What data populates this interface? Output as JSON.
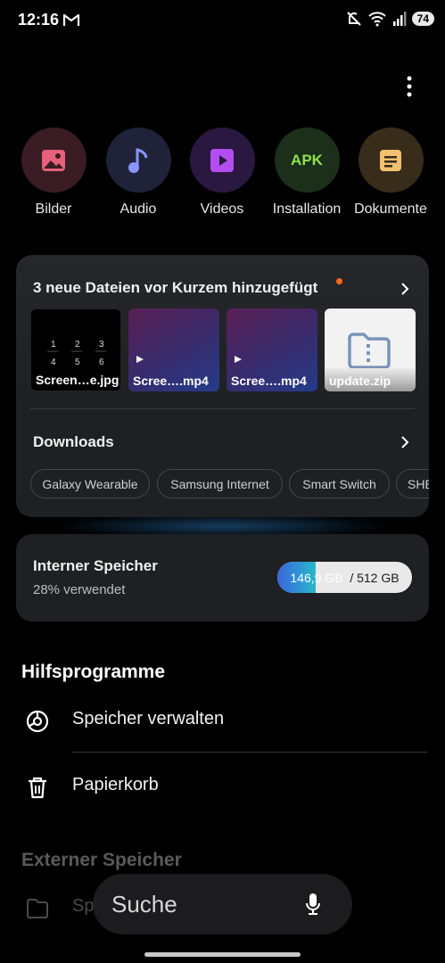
{
  "status": {
    "time": "12:16",
    "battery": "74"
  },
  "categories": [
    {
      "label": "Bilder",
      "icon": "image-icon",
      "bg": "#3a1c24",
      "fg": "#e8607a"
    },
    {
      "label": "Audio",
      "icon": "music-note-icon",
      "bg": "#1f2238",
      "fg": "#8a95ff"
    },
    {
      "label": "Videos",
      "icon": "play-icon",
      "bg": "#2a1840",
      "fg": "#b44df0"
    },
    {
      "label": "Installation",
      "icon": "apk-icon",
      "bg": "#1b2f1b",
      "fg": "#8ee24a",
      "glyph": "APK"
    },
    {
      "label": "Dokumente",
      "icon": "document-icon",
      "bg": "#382c1a",
      "fg": "#f2c170"
    }
  ],
  "recent": {
    "title": "3 neue Dateien vor Kurzem hinzugefügt",
    "files": [
      {
        "name": "Screen…e.jpg",
        "type": "image",
        "keys": [
          "1",
          "2",
          "3",
          "4",
          "5",
          "6"
        ]
      },
      {
        "name": "Scree….mp4",
        "type": "video"
      },
      {
        "name": "Scree….mp4",
        "type": "video"
      },
      {
        "name": "update.zip",
        "type": "zip"
      }
    ]
  },
  "downloads": {
    "title": "Downloads",
    "chips": [
      "Galaxy Wearable",
      "Samsung Internet",
      "Smart Switch",
      "SHE"
    ]
  },
  "storage": {
    "title": "Interner Speicher",
    "subtitle": "28% verwendet",
    "used": "146,9 GB",
    "total": "/ 512 GB",
    "used_fraction": 0.287
  },
  "utilities": {
    "title": "Hilfsprogramme",
    "items": [
      {
        "label": "Speicher verwalten",
        "icon": "storage-analysis-icon"
      },
      {
        "label": "Papierkorb",
        "icon": "trash-icon"
      }
    ]
  },
  "external": {
    "title": "Externer Speicher",
    "item_label": "Sp"
  },
  "search": {
    "label": "Suche"
  }
}
